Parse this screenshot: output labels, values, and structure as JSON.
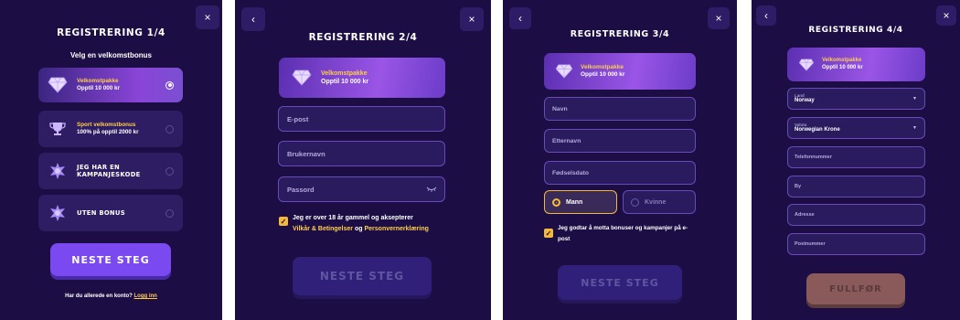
{
  "common": {
    "close_icon": "×",
    "back_icon": "‹"
  },
  "step1": {
    "title": "REGISTRERING 1/4",
    "subtitle": "Velg en velkomstbonus",
    "options": [
      {
        "line1": "Velkomstpakke",
        "line2": "Opptil 10 000 kr",
        "icon": "diamond-icon",
        "selected": true
      },
      {
        "line1": "Sport velkomstbonus",
        "line2": "100% på opptil 2000 kr",
        "icon": "trophy-icon",
        "selected": false
      },
      {
        "line1": "JEG HAR EN",
        "line2": "KAMPANJESKODE",
        "icon": "badge-icon",
        "selected": false
      },
      {
        "line1": "UTEN BONUS",
        "line2": "",
        "icon": "badge-icon",
        "selected": false
      }
    ],
    "next_label": "NESTE STEG",
    "footer_text": "Har du allerede en konto?",
    "login_link": "Logg inn"
  },
  "step2": {
    "title": "REGISTRERING 2/4",
    "package_name": "Velkomstpakke",
    "package_value": "Opptil 10 000 kr",
    "email_placeholder": "E-post",
    "username_placeholder": "Brukernavn",
    "password_placeholder": "Passord",
    "terms_prefix": "Jeg er over 18 år gammel og aksepterer",
    "terms_link": "Vilkår & Betingelser",
    "terms_and": "og",
    "privacy_link": "Personvernerklæring",
    "next_label": "NESTE STEG"
  },
  "step3": {
    "title": "REGISTRERING 3/4",
    "package_name": "Velkomstpakke",
    "package_value": "Opptil 10 000 kr",
    "first_name_placeholder": "Navn",
    "last_name_placeholder": "Etternavn",
    "birthdate_placeholder": "Fødselsdato",
    "gender_male": "Mann",
    "gender_female": "Kvinne",
    "consent_text": "Jeg godtar å motta bonuser og kampanjer på e-post",
    "next_label": "NESTE STEG"
  },
  "step4": {
    "title": "REGISTRERING 4/4",
    "package_name": "Velkomstpakke",
    "package_value": "Opptil 10 000 kr",
    "country_label": "Land",
    "country_value": "Norway",
    "currency_label": "Valuta",
    "currency_value": "Norwegian Krone",
    "phone_placeholder": "Telefonnummer",
    "city_placeholder": "By",
    "address_placeholder": "Adresse",
    "postcode_placeholder": "Postnummer",
    "finish_label": "FULLFØR"
  },
  "colors": {
    "panel_bg": "#1c0e45",
    "accent_purple": "#7a49ef",
    "highlight_yellow": "#ffce4d",
    "disabled_button": "#30207a"
  }
}
